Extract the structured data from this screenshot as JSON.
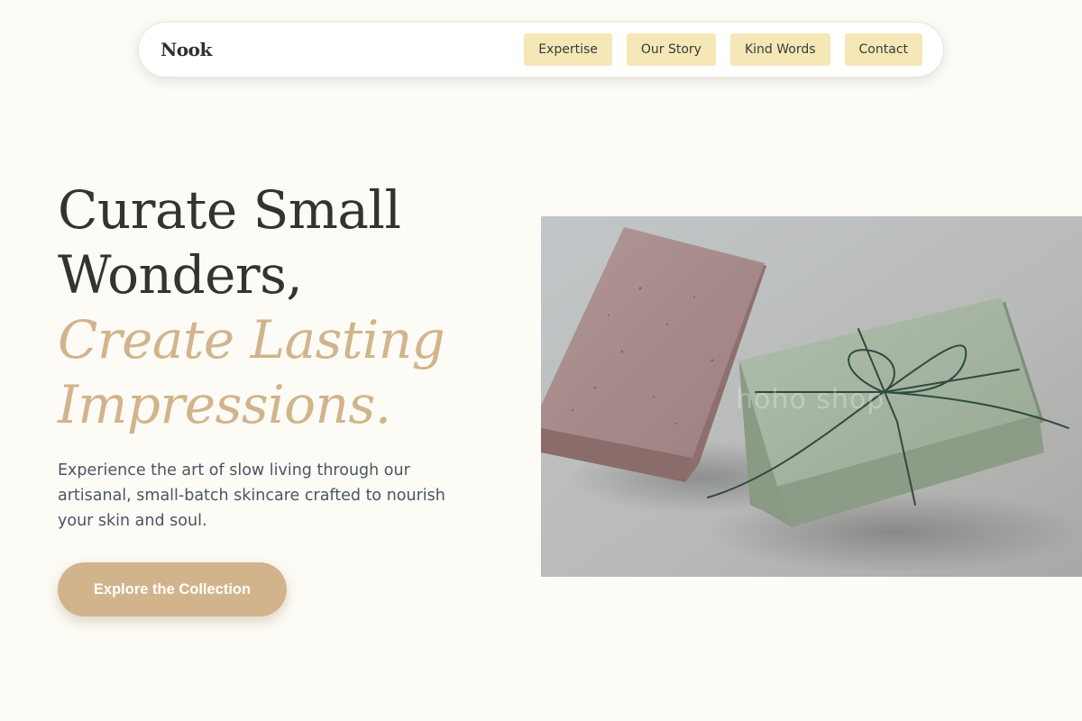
{
  "nav": {
    "brand": "Nook",
    "links": [
      {
        "label": "Expertise"
      },
      {
        "label": "Our Story"
      },
      {
        "label": "Kind Words"
      },
      {
        "label": "Contact"
      }
    ]
  },
  "hero": {
    "headline": {
      "line1": "Curate Small",
      "line2": "Wonders,",
      "accent1": "Create Lasting",
      "accent2": "Impressions."
    },
    "subcopy": "Experience the art of slow living through our artisanal, small-batch skincare crafted to nourish your skin and soul.",
    "cta_label": "Explore the Collection",
    "image": {
      "alt": "Two handmade soap bars, one pink and one green tied with twine",
      "watermark": "hoho shop"
    }
  },
  "colors": {
    "background": "#fcfbf5",
    "accent": "#d2b48c",
    "nav_pill": "#f5e7b6",
    "heading": "#333333",
    "body_text": "#4a5565"
  }
}
